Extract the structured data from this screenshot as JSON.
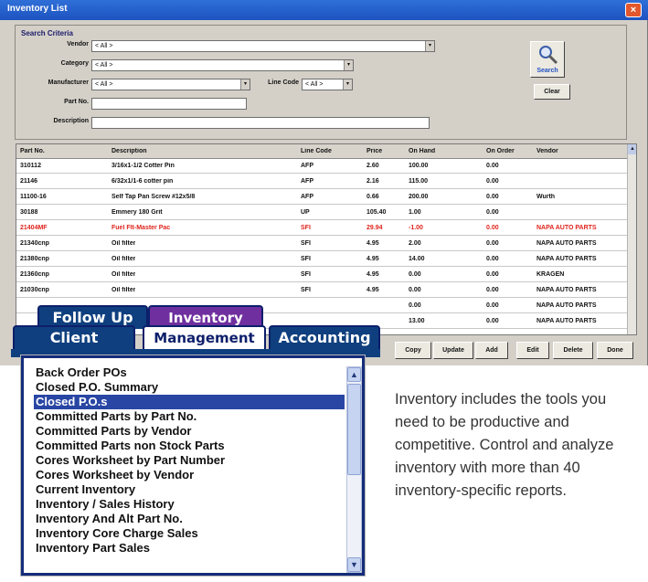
{
  "window": {
    "title": "Inventory List",
    "close_glyph": "×"
  },
  "search_criteria": {
    "legend": "Search Criteria",
    "vendor_label": "Vendor",
    "vendor_value": "< All >",
    "category_label": "Category",
    "category_value": "< All >",
    "manufacturer_label": "Manufacturer",
    "manufacturer_value": "< All >",
    "line_code_label": "Line Code",
    "line_code_value": "< All >",
    "part_no_label": "Part No.",
    "part_no_value": "",
    "description_label": "Description",
    "description_value": "",
    "search_button": "Search",
    "clear_button": "Clear",
    "dropdown_glyph": "▾"
  },
  "grid": {
    "columns": [
      "Part No.",
      "Description",
      "Line Code",
      "Price",
      "On Hand",
      "On Order",
      "Vendor"
    ],
    "rows": [
      [
        "310112",
        "3/16x1-1/2 Cotter Pin",
        "AFP",
        "2.60",
        "100.00",
        "0.00",
        ""
      ],
      [
        "21146",
        "6/32x1/1-6 cotter pin",
        "AFP",
        "2.16",
        "115.00",
        "0.00",
        ""
      ],
      [
        "11100-16",
        "Self Tap Pan Screw #12x5/8",
        "AFP",
        "0.66",
        "200.00",
        "0.00",
        "Wurth"
      ],
      [
        "30188",
        "Emmery 180 Grit",
        "UP",
        "105.40",
        "1.00",
        "0.00",
        ""
      ],
      [
        "21404MF",
        "Fuel Flt-Master Pac",
        "SFI",
        "29.94",
        "-1.00",
        "0.00",
        "NAPA AUTO PARTS"
      ],
      [
        "21340cnp",
        "Oil filter",
        "SFI",
        "4.95",
        "2.00",
        "0.00",
        "NAPA AUTO PARTS"
      ],
      [
        "21380cnp",
        "Oil filter",
        "SFI",
        "4.95",
        "14.00",
        "0.00",
        "NAPA AUTO PARTS"
      ],
      [
        "21360cnp",
        "Oil filter",
        "SFI",
        "4.95",
        "0.00",
        "0.00",
        "KRAGEN"
      ],
      [
        "21030cnp",
        "Oil filter",
        "SFI",
        "4.95",
        "0.00",
        "0.00",
        "NAPA AUTO PARTS"
      ],
      [
        "",
        "",
        "",
        "",
        "0.00",
        "0.00",
        "NAPA AUTO PARTS"
      ],
      [
        "",
        "",
        "",
        "",
        "13.00",
        "0.00",
        "NAPA AUTO PARTS"
      ]
    ],
    "highlight_row_index": 4,
    "highlight_color": "#e0241c",
    "scroll_up_glyph": "▲"
  },
  "actions": {
    "copy": "Copy",
    "update": "Update",
    "add": "Add",
    "edit": "Edit",
    "delete": "Delete",
    "done": "Done"
  },
  "tabs": {
    "follow_up": "Follow Up",
    "inventory": "Inventory",
    "client": "Client",
    "management": "Management",
    "accounting": "Accounting",
    "active": "Inventory"
  },
  "reports": {
    "items": [
      "Back Order POs",
      "Closed P.O. Summary",
      "Closed P.O.s",
      "Committed Parts by Part No.",
      "Committed Parts by Vendor",
      "Committed Parts non Stock Parts",
      "Cores Worksheet by Part Number",
      "Cores Worksheet by Vendor",
      "Current Inventory",
      "Inventory / Sales History",
      "Inventory And Alt Part No.",
      "Inventory Core Charge Sales",
      "Inventory Part Sales"
    ],
    "selected_index": 2,
    "scroll_up_glyph": "▲",
    "scroll_down_glyph": "▼"
  },
  "caption": "Inventory includes the tools you need to be productive and competitive. Control and analyze inventory with more than 40 inventory-specific reports.",
  "colors": {
    "title_bar": "#1d53c0",
    "tab_dark": "#0f3f7e",
    "tab_active": "#6f2f9f",
    "selection": "#2946a4",
    "alert_row": "#e0241c"
  }
}
